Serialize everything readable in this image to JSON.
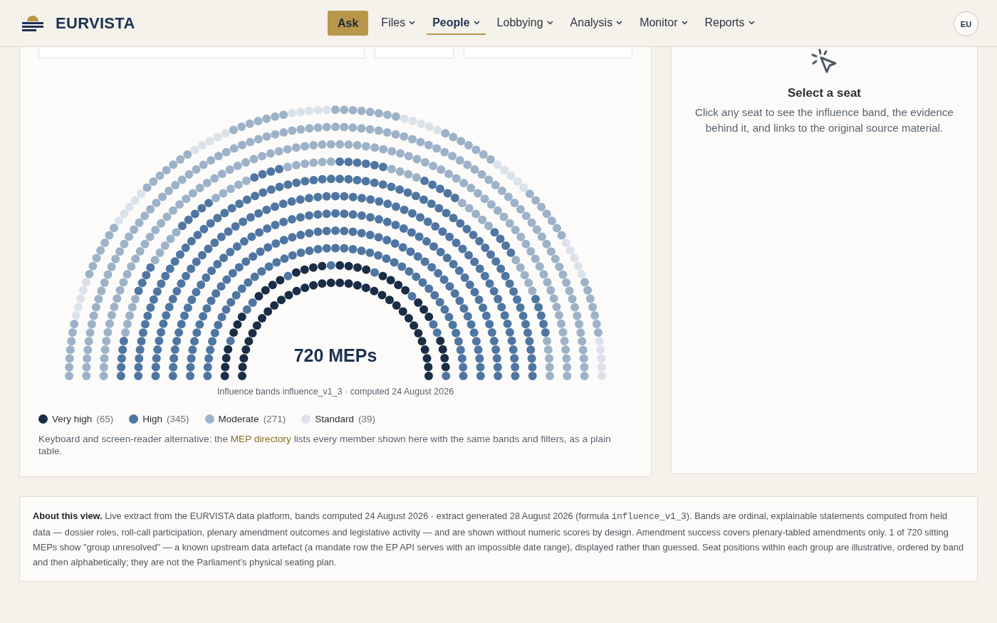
{
  "brand": {
    "name": "EURVISTA"
  },
  "nav": [
    {
      "label": "Ask",
      "kind": "action"
    },
    {
      "label": "Files",
      "kind": "menu",
      "selected": false
    },
    {
      "label": "People",
      "kind": "menu",
      "selected": true
    },
    {
      "label": "Lobbying",
      "kind": "menu",
      "selected": false
    },
    {
      "label": "Analysis",
      "kind": "menu",
      "selected": false
    },
    {
      "label": "Monitor",
      "kind": "menu",
      "selected": false
    },
    {
      "label": "Reports",
      "kind": "menu",
      "selected": false
    }
  ],
  "account": {
    "initials": "EU"
  },
  "hemicycle": {
    "total": "720 MEPs",
    "caption": "Influence bands influence_v1_3 · computed 24 August 2026"
  },
  "legend": [
    {
      "label": "Very high",
      "count": "(65)",
      "color": "#1a2d46"
    },
    {
      "label": "High",
      "count": "(345)",
      "color": "#4f76a2"
    },
    {
      "label": "Moderate",
      "count": "(271)",
      "color": "#9db2c8"
    },
    {
      "label": "Standard",
      "count": "(39)",
      "color": "#dce2ea"
    }
  ],
  "note": {
    "before": "Keyboard and screen-reader alternative: the ",
    "link": "MEP directory",
    "after": " lists every member shown here with the same bands and filters, as a plain table."
  },
  "detail": {
    "title": "Select a seat",
    "text": "Click any seat to see the influence band, the evidence behind it, and links to the original source material."
  },
  "about": [
    {
      "kind": "text",
      "text": "**About this view.** Live extract from the EURVISTA data platform, bands computed 24 August 2026 · extract generated 28 August 2026 (formula "
    },
    {
      "kind": "code",
      "text": "influence_v1_3"
    },
    {
      "kind": "text",
      "text": "). Bands are ordinal, explainable statements computed from held data — dossier roles, roll-call participation, plenary amendment outcomes and legislative activity — and are shown without numeric scores by design. Amendment success covers plenary-tabled amendments only. 1 of 720 sitting MEPs show \"group unresolved\" — a known upstream data artefact (a mandate row the EP API serves with an impossible date range), displayed rather than guessed. Seat positions within each group are illustrative, ordered by band and then alphabetically; they are not the Parliament's physical seating plan."
    }
  ]
}
